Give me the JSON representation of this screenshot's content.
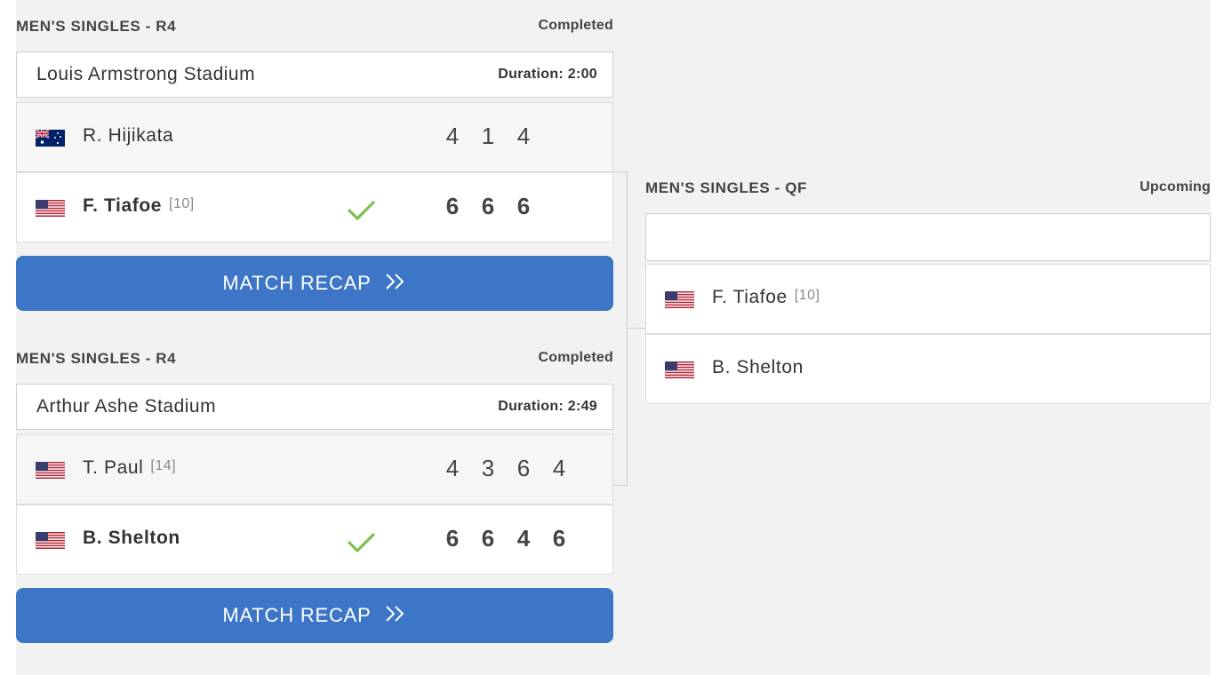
{
  "matches": [
    {
      "round": "MEN'S SINGLES - R4",
      "status": "Completed",
      "venue": "Louis Armstrong Stadium",
      "duration": "Duration: 2:00",
      "players": [
        {
          "name": "R. Hijikata",
          "seed": "",
          "flag": "AUS",
          "winner": false,
          "scores": [
            "4",
            "1",
            "4"
          ]
        },
        {
          "name": "F. Tiafoe",
          "seed": "[10]",
          "flag": "USA",
          "winner": true,
          "scores": [
            "6",
            "6",
            "6"
          ]
        }
      ],
      "recap_label": "MATCH RECAP"
    },
    {
      "round": "MEN'S SINGLES - R4",
      "status": "Completed",
      "venue": "Arthur Ashe Stadium",
      "duration": "Duration: 2:49",
      "players": [
        {
          "name": "T. Paul",
          "seed": "[14]",
          "flag": "USA",
          "winner": false,
          "scores": [
            "4",
            "3",
            "6",
            "4"
          ]
        },
        {
          "name": "B. Shelton",
          "seed": "",
          "flag": "USA",
          "winner": true,
          "scores": [
            "6",
            "6",
            "4",
            "6"
          ]
        }
      ],
      "recap_label": "MATCH RECAP"
    }
  ],
  "quarterfinal": {
    "round": "MEN'S SINGLES - QF",
    "status": "Upcoming",
    "venue": "",
    "players": [
      {
        "name": "F. Tiafoe",
        "seed": "[10]",
        "flag": "USA"
      },
      {
        "name": "B. Shelton",
        "seed": "",
        "flag": "USA"
      }
    ]
  },
  "colors": {
    "recap_button": "#3d76c6",
    "winner_check": "#7cc04b",
    "background": "#f2f2f2"
  },
  "icons": {
    "winner": "checkmark-icon",
    "recap": "double-chevron-right-icon"
  }
}
